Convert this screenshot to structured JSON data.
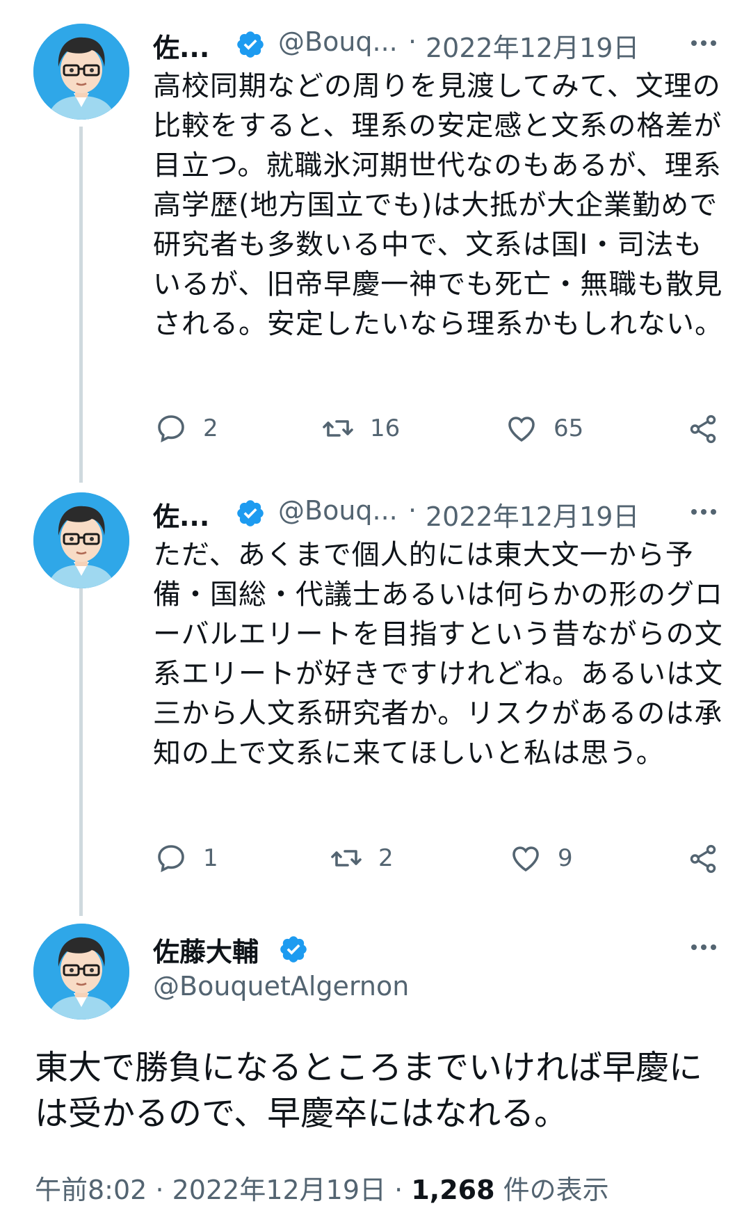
{
  "tweets": [
    {
      "name": "佐...",
      "handle": "@Bouq...",
      "sep": "·",
      "date": "2022年12月19日",
      "text": "高校同期などの周りを見渡してみて、文理の比較をすると、理系の安定感と文系の格差が目立つ。就職氷河期世代なのもあるが、理系高学歴(地方国立でも)は大抵が大企業勤めで研究者も多数いる中で、文系は国I・司法もいるが、旧帝早慶一神でも死亡・無職も散見される。安定したいなら理系かもしれない。",
      "replies": "2",
      "retweets": "16",
      "likes": "65"
    },
    {
      "name": "佐...",
      "handle": "@Bouq...",
      "sep": "·",
      "date": "2022年12月19日",
      "text": "ただ、あくまで個人的には東大文一から予備・国総・代議士あるいは何らかの形のグローバルエリートを目指すという昔ながらの文系エリートが好きですけれどね。あるいは文三から人文系研究者か。リスクがあるのは承知の上で文系に来てほしいと私は思う。",
      "replies": "1",
      "retweets": "2",
      "likes": "9"
    }
  ],
  "main_tweet": {
    "name": "佐藤大輔",
    "handle": "@BouquetAlgernon",
    "text": "東大で勝負になるところまでいければ早慶には受かるので、早慶卒にはなれる。",
    "time": "午前8:02",
    "sep1": "·",
    "date": "2022年12月19日",
    "sep2": "·",
    "views_count": "1,268",
    "views_label": "件の表示"
  },
  "colors": {
    "verified": "#1d9bf0",
    "secondary_text": "#536471",
    "thread_line": "#cfd9de",
    "avatar_bg": "#2fa7e8"
  },
  "icons": [
    "verified-badge-icon",
    "more-icon",
    "reply-icon",
    "retweet-icon",
    "like-icon",
    "share-icon"
  ]
}
